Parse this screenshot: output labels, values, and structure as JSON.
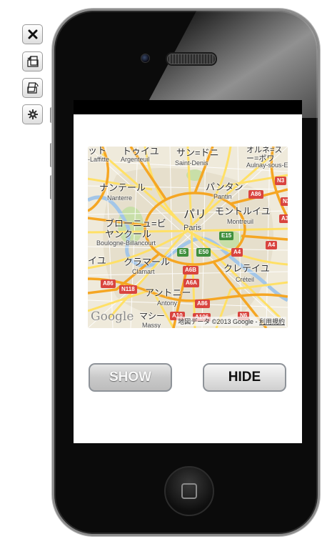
{
  "toolbar": {
    "close_icon": "close-icon",
    "rotate_left_icon": "rotate-left-icon",
    "rotate_right_icon": "rotate-right-icon",
    "settings_icon": "gear-icon"
  },
  "map": {
    "labels_jp": {
      "top_left": "ット",
      "taverny": "トゥイユ",
      "saint_denis": "サン=ドニ",
      "aulnay": "オルネ=スー=ボワ",
      "nanterre": "ナンテール",
      "pantin": "パンタン",
      "paris": "パリ",
      "montreuil": "モントルイユ",
      "boulogne": "ブローニュ=ビヤンクール",
      "clamart": "クラマール",
      "creteil": "クレテイユ",
      "antony": "アントニー",
      "massy": "マシー",
      "vitry": "イユ"
    },
    "labels_en": {
      "laffitte": "-Laffitte",
      "argenteuil": "Argenteuil",
      "saint_denis": "Saint-Denis",
      "aulnay": "Aulnay-sous-E",
      "nanterre": "Nanterre",
      "pantin": "Pantin",
      "paris": "Paris",
      "montreuil": "Montreuil",
      "boulogne": "Boulogne-Billancourt",
      "clamart": "Clamart",
      "creteil": "Créteil",
      "antony": "Antony",
      "massy": "Massy"
    },
    "shields": {
      "n3": "N3",
      "n3b": "N3",
      "a86_top": "A86",
      "a3": "A3",
      "e15": "E15",
      "e5": "E5",
      "e50": "E50",
      "a4_mid": "A4",
      "a4_right": "A4",
      "a6b": "A6B",
      "a6a": "A6A",
      "a86_left": "A86",
      "n118": "N118",
      "a86_bottom": "A86",
      "a10": "A10",
      "a106": "A106",
      "n6": "N6"
    },
    "google_logo": "Google",
    "attribution": "地図データ ©2013 Google - ",
    "terms": "利用規約",
    "colors": {
      "land": "#f2efe4",
      "urban": "#e9e4d4",
      "highway": "#f5a623",
      "major_road": "#ffe066",
      "water": "#a3c6e8",
      "park": "#c8dfa8"
    }
  },
  "buttons": {
    "show": "SHOW",
    "hide": "HIDE"
  }
}
